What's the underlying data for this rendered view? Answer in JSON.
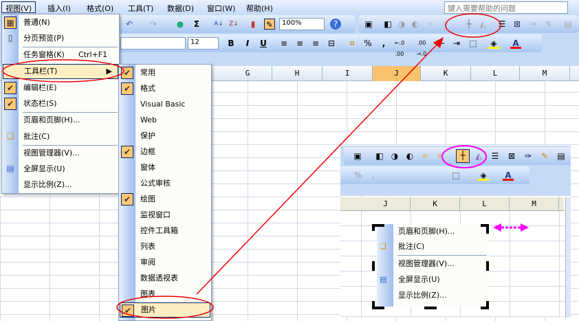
{
  "menubar": {
    "items": [
      "视图(V)",
      "插入(I)",
      "格式(O)",
      "工具(T)",
      "数据(D)",
      "窗口(W)",
      "帮助(H)"
    ],
    "help_placeholder": "键入需要帮助的问题"
  },
  "toolbar": {
    "zoom": "100%",
    "font_size": "12",
    "bold": "B",
    "italic": "I",
    "underline": "U",
    "percent": "%",
    "comma": ",",
    "inc_decimal": "←.0 .00",
    "dec_decimal": ".00 →.0",
    "font_color_letter": "A"
  },
  "columns": [
    "G",
    "H",
    "I",
    "J",
    "K",
    "L",
    "M"
  ],
  "view_menu": {
    "items": [
      {
        "label": "普通(N)",
        "icon": "normal-view-icon",
        "checked": true
      },
      {
        "label": "分页预览(P)",
        "icon": "page-break-icon"
      },
      {
        "label": "任务窗格(K)",
        "shortcut": "Ctrl+F1"
      },
      {
        "label": "工具栏(T)",
        "submenu": true
      },
      {
        "label": "编辑栏(E)",
        "checked": true
      },
      {
        "label": "状态栏(S)",
        "checked": true
      },
      {
        "label": "页眉和页脚(H)..."
      },
      {
        "label": "批注(C)",
        "icon": "comment-icon"
      },
      {
        "label": "视图管理器(V)..."
      },
      {
        "label": "全屏显示(U)",
        "icon": "fullscreen-icon"
      },
      {
        "label": "显示比例(Z)..."
      }
    ]
  },
  "toolbars_submenu": {
    "items": [
      {
        "label": "常用",
        "checked": true
      },
      {
        "label": "格式",
        "checked": true
      },
      {
        "label": "Visual Basic"
      },
      {
        "label": "Web"
      },
      {
        "label": "保护"
      },
      {
        "label": "边框",
        "checked": true
      },
      {
        "label": "窗体"
      },
      {
        "label": "公式审核"
      },
      {
        "label": "绘图",
        "checked": true
      },
      {
        "label": "监视窗口"
      },
      {
        "label": "控件工具箱"
      },
      {
        "label": "列表"
      },
      {
        "label": "审阅"
      },
      {
        "label": "数据透视表"
      },
      {
        "label": "图表"
      },
      {
        "label": "图片",
        "checked": true
      }
    ]
  },
  "inset": {
    "columns": [
      "J",
      "K",
      "L",
      "M"
    ],
    "menu_items": [
      "页眉和页脚(H)...",
      "批注(C)",
      "视图管理器(V)...",
      "全屏显示(U)",
      "显示比例(Z)..."
    ]
  },
  "colors": {
    "annotation_red": "#e00000",
    "annotation_magenta": "#ff00ff",
    "highlight": "#f9c26d"
  }
}
